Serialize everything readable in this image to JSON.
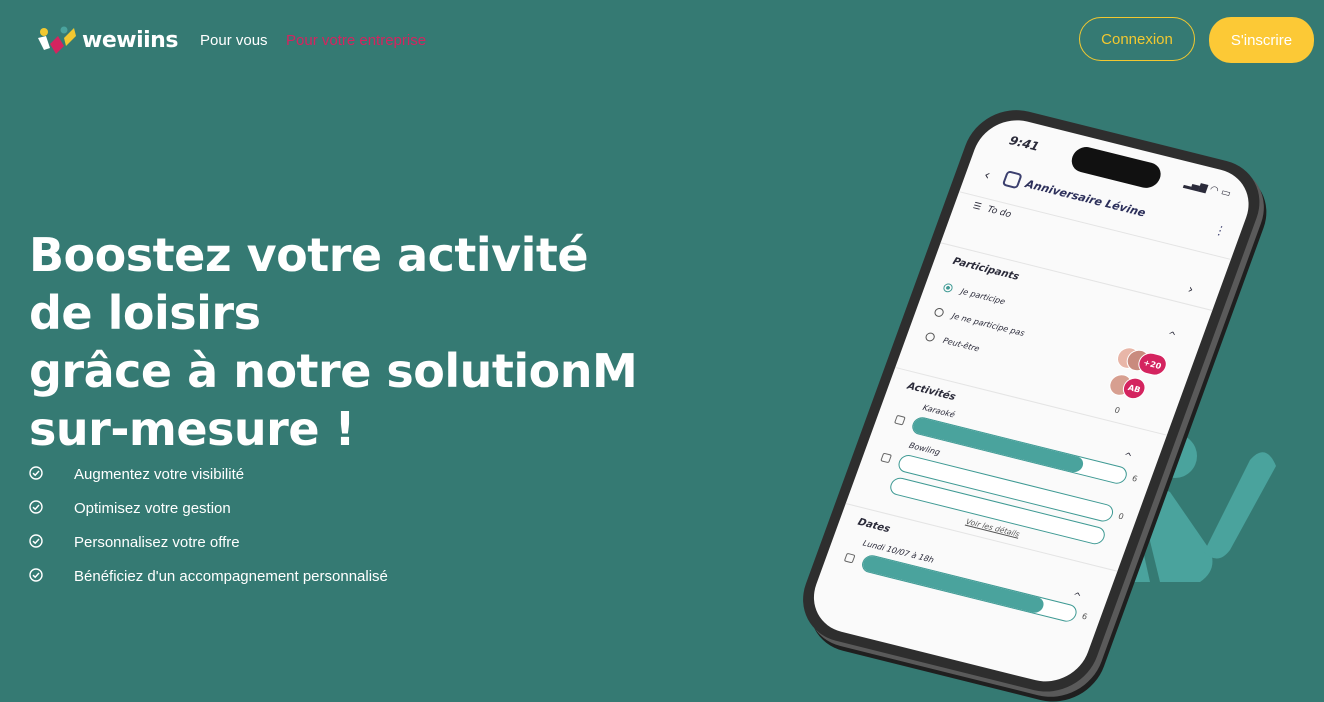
{
  "brand": {
    "name": "wewiins",
    "colors": {
      "background": "#357a73",
      "accent_yellow": "#fcc936",
      "accent_pink": "#d4245f",
      "teal": "#4aa39d"
    }
  },
  "nav": {
    "links": [
      {
        "label": "Pour vous"
      },
      {
        "label": "Pour votre entreprise"
      }
    ],
    "login_label": "Connexion",
    "signup_label": "S'inscrire"
  },
  "hero": {
    "title_lines": [
      "Boostez votre activité",
      "de loisirs",
      "grâce à notre solutionM",
      "sur-mesure !"
    ],
    "features": [
      {
        "icon": "check-circle-icon",
        "label": "Augmentez votre visibilité"
      },
      {
        "icon": "check-circle-icon",
        "label": "Optimisez votre gestion"
      },
      {
        "icon": "check-circle-icon",
        "label": "Personnalisez votre offre"
      },
      {
        "icon": "check-circle-icon",
        "label": "Bénéficiez d'un accompagnement personnalisé"
      }
    ]
  },
  "phone": {
    "time": "9:41",
    "event_title": "Anniversaire Lévine",
    "todo_label": "To do",
    "participants": {
      "heading": "Participants",
      "options": [
        {
          "label": "Je participe",
          "selected": true,
          "badge": "+20"
        },
        {
          "label": "Je ne participe pas",
          "selected": false,
          "badge": "AB"
        },
        {
          "label": "Peut-être",
          "selected": false,
          "badge": "0"
        }
      ]
    },
    "activities": {
      "heading": "Activités",
      "items": [
        {
          "label": "Karaoké",
          "count": "6",
          "fill": 0.8
        },
        {
          "label": "Bowling",
          "count": "0",
          "fill": 0
        }
      ],
      "details_link": "Voir les détails"
    },
    "dates": {
      "heading": "Dates",
      "items": [
        {
          "label": "Lundi 10/07 à 18h",
          "count": "6",
          "fill": 0.85
        }
      ]
    }
  }
}
